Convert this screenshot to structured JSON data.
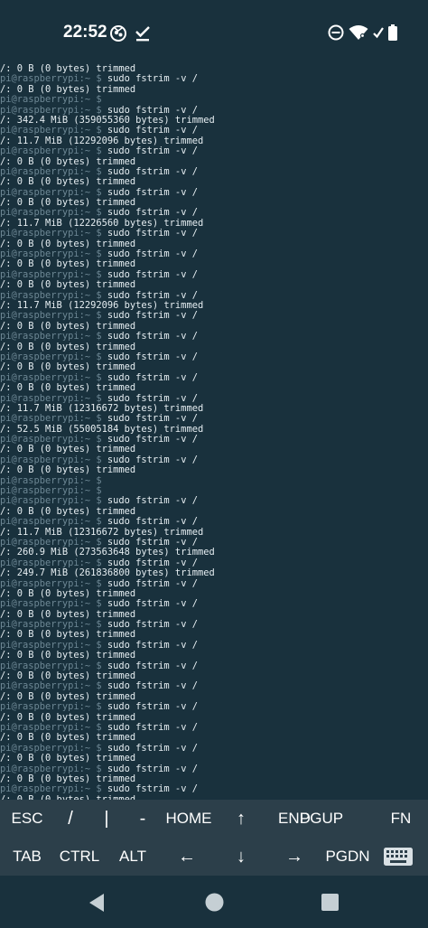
{
  "status_bar": {
    "time": "22:52",
    "left_icons": [
      "raspberry-notification-icon",
      "check-icon"
    ],
    "right_icons": [
      "do-not-disturb-icon",
      "wifi-icon",
      "battery-icon"
    ]
  },
  "terminal": {
    "prompt": "pi@raspberrypi:~ $",
    "lines": [
      {
        "type": "output",
        "text": "/: 0 B (0 bytes) trimmed"
      },
      {
        "type": "cmd",
        "text": " sudo fstrim -v /"
      },
      {
        "type": "output",
        "text": "/: 0 B (0 bytes) trimmed"
      },
      {
        "type": "cmd",
        "text": ""
      },
      {
        "type": "cmd",
        "text": " sudo fstrim -v /"
      },
      {
        "type": "output",
        "text": "/: 342.4 MiB (359055360 bytes) trimmed"
      },
      {
        "type": "cmd",
        "text": " sudo fstrim -v /"
      },
      {
        "type": "output",
        "text": "/: 11.7 MiB (12292096 bytes) trimmed"
      },
      {
        "type": "cmd",
        "text": " sudo fstrim -v /"
      },
      {
        "type": "output",
        "text": "/: 0 B (0 bytes) trimmed"
      },
      {
        "type": "cmd",
        "text": " sudo fstrim -v /"
      },
      {
        "type": "output",
        "text": "/: 0 B (0 bytes) trimmed"
      },
      {
        "type": "cmd",
        "text": " sudo fstrim -v /"
      },
      {
        "type": "output",
        "text": "/: 0 B (0 bytes) trimmed"
      },
      {
        "type": "cmd",
        "text": " sudo fstrim -v /"
      },
      {
        "type": "output",
        "text": "/: 11.7 MiB (12226560 bytes) trimmed"
      },
      {
        "type": "cmd",
        "text": " sudo fstrim -v /"
      },
      {
        "type": "output",
        "text": "/: 0 B (0 bytes) trimmed"
      },
      {
        "type": "cmd",
        "text": " sudo fstrim -v /"
      },
      {
        "type": "output",
        "text": "/: 0 B (0 bytes) trimmed"
      },
      {
        "type": "cmd",
        "text": " sudo fstrim -v /"
      },
      {
        "type": "output",
        "text": "/: 0 B (0 bytes) trimmed"
      },
      {
        "type": "cmd",
        "text": " sudo fstrim -v /"
      },
      {
        "type": "output",
        "text": "/: 11.7 MiB (12292096 bytes) trimmed"
      },
      {
        "type": "cmd",
        "text": " sudo fstrim -v /"
      },
      {
        "type": "output",
        "text": "/: 0 B (0 bytes) trimmed"
      },
      {
        "type": "cmd",
        "text": " sudo fstrim -v /"
      },
      {
        "type": "output",
        "text": "/: 0 B (0 bytes) trimmed"
      },
      {
        "type": "cmd",
        "text": " sudo fstrim -v /"
      },
      {
        "type": "output",
        "text": "/: 0 B (0 bytes) trimmed"
      },
      {
        "type": "cmd",
        "text": " sudo fstrim -v /"
      },
      {
        "type": "output",
        "text": "/: 0 B (0 bytes) trimmed"
      },
      {
        "type": "cmd",
        "text": " sudo fstrim -v /"
      },
      {
        "type": "output",
        "text": "/: 11.7 MiB (12316672 bytes) trimmed"
      },
      {
        "type": "cmd",
        "text": " sudo fstrim -v /"
      },
      {
        "type": "output",
        "text": "/: 52.5 MiB (55005184 bytes) trimmed"
      },
      {
        "type": "cmd",
        "text": " sudo fstrim -v /"
      },
      {
        "type": "output",
        "text": "/: 0 B (0 bytes) trimmed"
      },
      {
        "type": "cmd",
        "text": " sudo fstrim -v /"
      },
      {
        "type": "output",
        "text": "/: 0 B (0 bytes) trimmed"
      },
      {
        "type": "cmd",
        "text": ""
      },
      {
        "type": "cmd",
        "text": ""
      },
      {
        "type": "cmd",
        "text": " sudo fstrim -v /"
      },
      {
        "type": "output",
        "text": "/: 0 B (0 bytes) trimmed"
      },
      {
        "type": "cmd",
        "text": " sudo fstrim -v /"
      },
      {
        "type": "output",
        "text": "/: 11.7 MiB (12316672 bytes) trimmed"
      },
      {
        "type": "cmd",
        "text": " sudo fstrim -v /"
      },
      {
        "type": "output",
        "text": "/: 260.9 MiB (273563648 bytes) trimmed"
      },
      {
        "type": "cmd",
        "text": " sudo fstrim -v /"
      },
      {
        "type": "output",
        "text": "/: 249.7 MiB (261836800 bytes) trimmed"
      },
      {
        "type": "cmd",
        "text": " sudo fstrim -v /"
      },
      {
        "type": "output",
        "text": "/: 0 B (0 bytes) trimmed"
      },
      {
        "type": "cmd",
        "text": " sudo fstrim -v /"
      },
      {
        "type": "output",
        "text": "/: 0 B (0 bytes) trimmed"
      },
      {
        "type": "cmd",
        "text": " sudo fstrim -v /"
      },
      {
        "type": "output",
        "text": "/: 0 B (0 bytes) trimmed"
      },
      {
        "type": "cmd",
        "text": " sudo fstrim -v /"
      },
      {
        "type": "output",
        "text": "/: 0 B (0 bytes) trimmed"
      },
      {
        "type": "cmd",
        "text": " sudo fstrim -v /"
      },
      {
        "type": "output",
        "text": "/: 0 B (0 bytes) trimmed"
      },
      {
        "type": "cmd",
        "text": " sudo fstrim -v /"
      },
      {
        "type": "output",
        "text": "/: 0 B (0 bytes) trimmed"
      },
      {
        "type": "cmd",
        "text": " sudo fstrim -v /"
      },
      {
        "type": "output",
        "text": "/: 0 B (0 bytes) trimmed"
      },
      {
        "type": "cmd",
        "text": " sudo fstrim -v /"
      },
      {
        "type": "output",
        "text": "/: 0 B (0 bytes) trimmed"
      },
      {
        "type": "cmd",
        "text": " sudo fstrim -v /"
      },
      {
        "type": "output",
        "text": "/: 0 B (0 bytes) trimmed"
      },
      {
        "type": "cmd",
        "text": " sudo fstrim -v /"
      },
      {
        "type": "output",
        "text": "/: 0 B (0 bytes) trimmed"
      },
      {
        "type": "cmd",
        "text": " sudo fstrim -v /"
      },
      {
        "type": "output",
        "text": "/: 0 B (0 bytes) trimmed"
      },
      {
        "type": "cmd",
        "text": " sudo fstrim -v /"
      },
      {
        "type": "output",
        "text": "/: 0 B (0 bytes) trimmed"
      },
      {
        "type": "cmd",
        "text": "",
        "cursor": true
      }
    ]
  },
  "extra_keys": {
    "row1": [
      "ESC",
      "/",
      "|",
      "-",
      "HOME",
      "↑",
      "END",
      "PGUP",
      "FN"
    ],
    "row2": [
      "TAB",
      "CTRL",
      "ALT",
      "←",
      "↓",
      "→",
      "PGDN"
    ],
    "keyboard_icon": "keyboard-icon"
  },
  "nav_bar": {
    "icons": [
      "back-icon",
      "home-icon",
      "recents-icon"
    ]
  },
  "colors": {
    "background": "#19313d",
    "extra_keys_bg": "#2c3f4a",
    "prompt": "#6d8794",
    "text": "#e6eef2"
  }
}
